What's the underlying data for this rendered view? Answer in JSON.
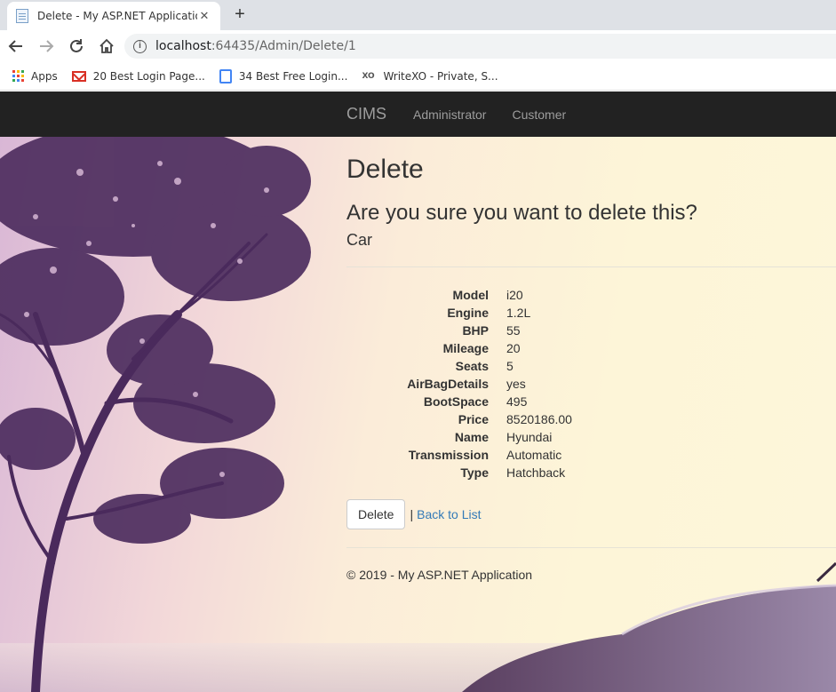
{
  "browser": {
    "tab_title": "Delete - My ASP.NET Application",
    "url_host": "localhost",
    "url_rest": ":64435/Admin/Delete/1",
    "bookmarks": [
      {
        "label": "Apps",
        "icon": "apps-grid-icon"
      },
      {
        "label": "20 Best Login Page...",
        "icon": "gmail-icon"
      },
      {
        "label": "34 Best Free Login...",
        "icon": "doc-icon"
      },
      {
        "label": "WriteXO - Private, S...",
        "icon": "xo-icon"
      }
    ]
  },
  "nav": {
    "brand": "CIMS",
    "links": [
      "Administrator",
      "Customer"
    ]
  },
  "main": {
    "title": "Delete",
    "confirm": "Are you sure you want to delete this?",
    "entity": "Car",
    "fields": [
      {
        "label": "Model",
        "value": "i20"
      },
      {
        "label": "Engine",
        "value": "1.2L"
      },
      {
        "label": "BHP",
        "value": "55"
      },
      {
        "label": "Mileage",
        "value": "20"
      },
      {
        "label": "Seats",
        "value": "5"
      },
      {
        "label": "AirBagDetails",
        "value": "yes"
      },
      {
        "label": "BootSpace",
        "value": "495"
      },
      {
        "label": "Price",
        "value": "8520186.00"
      },
      {
        "label": "Name",
        "value": "Hyundai"
      },
      {
        "label": "Transmission",
        "value": "Automatic"
      },
      {
        "label": "Type",
        "value": "Hatchback"
      }
    ],
    "delete_button": "Delete",
    "separator": "|",
    "back_link": "Back to List"
  },
  "footer": {
    "text": "© 2019 - My ASP.NET Application"
  },
  "colors": {
    "navbar_bg": "#222222",
    "link": "#337ab7",
    "tree": "#4a2a5c"
  }
}
